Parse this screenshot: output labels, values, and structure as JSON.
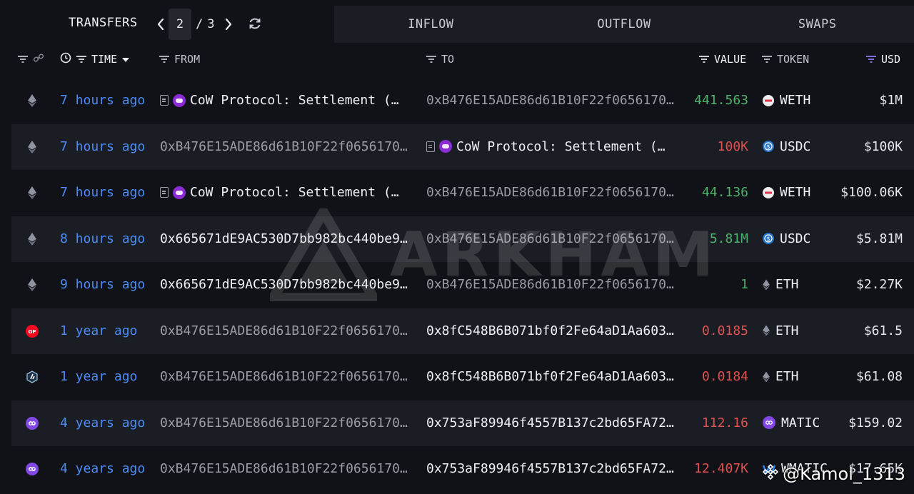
{
  "topbar": {
    "title": "TRANSFERS",
    "page_current": "2",
    "page_sep": "/",
    "page_total": "3",
    "tabs": [
      "INFLOW",
      "OUTFLOW",
      "SWAPS"
    ]
  },
  "columns": {
    "time": "TIME",
    "from": "FROM",
    "to": "TO",
    "value": "VALUE",
    "token": "TOKEN",
    "usd": "USD"
  },
  "rows": [
    {
      "chain": "ethereum-icon",
      "time": "7 hours ago",
      "from": "CoW Protocol: Settlement (…",
      "from_entity": true,
      "to": "0xB476E15ADE86d61B10F22f0656170…",
      "to_entity": false,
      "value": "441.563",
      "value_color": "green",
      "token": "WETH",
      "token_icon": "weth-icon",
      "usd": "$1M"
    },
    {
      "chain": "ethereum-icon",
      "time": "7 hours ago",
      "from": "0xB476E15ADE86d61B10F22f0656170…",
      "from_entity": false,
      "to": "CoW Protocol: Settlement (…",
      "to_entity": true,
      "value": "100K",
      "value_color": "red",
      "token": "USDC",
      "token_icon": "usdc-icon",
      "usd": "$100K"
    },
    {
      "chain": "ethereum-icon",
      "time": "7 hours ago",
      "from": "CoW Protocol: Settlement (…",
      "from_entity": true,
      "to": "0xB476E15ADE86d61B10F22f0656170…",
      "to_entity": false,
      "value": "44.136",
      "value_color": "green",
      "token": "WETH",
      "token_icon": "weth-icon",
      "usd": "$100.06K"
    },
    {
      "chain": "ethereum-icon",
      "time": "8 hours ago",
      "from": "0x665671dE9AC530D7bb982bc440be9…",
      "from_entity": false,
      "from_bright": true,
      "to": "0xB476E15ADE86d61B10F22f0656170…",
      "to_entity": false,
      "value": "5.81M",
      "value_color": "green",
      "token": "USDC",
      "token_icon": "usdc-icon",
      "usd": "$5.81M"
    },
    {
      "chain": "ethereum-icon",
      "time": "9 hours ago",
      "from": "0x665671dE9AC530D7bb982bc440be9…",
      "from_entity": false,
      "from_bright": true,
      "to": "0xB476E15ADE86d61B10F22f0656170…",
      "to_entity": false,
      "value": "1",
      "value_color": "green",
      "token": "ETH",
      "token_icon": "eth-icon",
      "usd": "$2.27K"
    },
    {
      "chain": "optimism-icon",
      "time": "1 year ago",
      "from": "0xB476E15ADE86d61B10F22f0656170…",
      "from_entity": false,
      "to": "0x8fC548B6B071bf0f2Fe64aD1Aa603…",
      "to_entity": false,
      "to_bright": true,
      "value": "0.0185",
      "value_color": "red",
      "token": "ETH",
      "token_icon": "eth-icon",
      "usd": "$61.5"
    },
    {
      "chain": "arbitrum-icon",
      "time": "1 year ago",
      "from": "0xB476E15ADE86d61B10F22f0656170…",
      "from_entity": false,
      "to": "0x8fC548B6B071bf0f2Fe64aD1Aa603…",
      "to_entity": false,
      "to_bright": true,
      "value": "0.0184",
      "value_color": "red",
      "token": "ETH",
      "token_icon": "eth-icon",
      "usd": "$61.08"
    },
    {
      "chain": "polygon-icon",
      "time": "4 years ago",
      "from": "0xB476E15ADE86d61B10F22f0656170…",
      "from_entity": false,
      "to": "0x753aF89946f4557B137c2bd65FA72…",
      "to_entity": false,
      "to_bright": true,
      "value": "112.16",
      "value_color": "red",
      "token": "MATIC",
      "token_icon": "matic-icon",
      "usd": "$159.02"
    },
    {
      "chain": "polygon-icon",
      "time": "4 years ago",
      "from": "0xB476E15ADE86d61B10F22f0656170…",
      "from_entity": false,
      "to": "0x753aF89946f4557B137c2bd65FA72…",
      "to_entity": false,
      "to_bright": true,
      "value": "12.407K",
      "value_color": "red",
      "token": "WMATIC",
      "token_icon": "wmatic-icon",
      "usd": "$17.65K"
    }
  ],
  "watermark": "ARKHAM",
  "credit": "@Kamol_1313",
  "colors": {
    "green": "#4db36a",
    "red": "#e0504e",
    "link": "#4b8cf5",
    "bg": "#111217",
    "row_alt": "#1b1d24"
  }
}
